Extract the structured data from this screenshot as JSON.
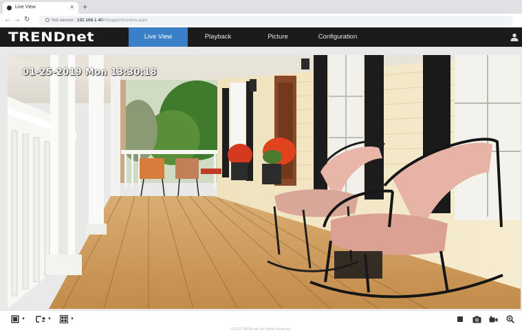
{
  "browser": {
    "tab_title": "Live View",
    "address": {
      "secure_label": "Not secure",
      "host": "192.168.1.40",
      "path": "/#/pages/liveview.aspx"
    }
  },
  "app": {
    "logo": "TRENDnet",
    "nav": [
      {
        "label": "Live View",
        "active": true
      },
      {
        "label": "Playback",
        "active": false
      },
      {
        "label": "Picture",
        "active": false
      },
      {
        "label": "Configuration",
        "active": false
      }
    ]
  },
  "video": {
    "osd_timestamp": "01-25-2019 Mon 13:30:18"
  },
  "toolbar": {
    "left_tools": [
      "window-layout-icon",
      "stream-select-icon",
      "aspect-ratio-icon"
    ],
    "right_tools": [
      "stop-icon",
      "snapshot-icon",
      "record-icon",
      "zoom-icon"
    ]
  },
  "footer": {
    "copyright": "©2019 TRENDnet. All Rights Reserved."
  },
  "colors": {
    "header_bg": "#1b1b1b",
    "active_tab": "#3a80c9"
  }
}
